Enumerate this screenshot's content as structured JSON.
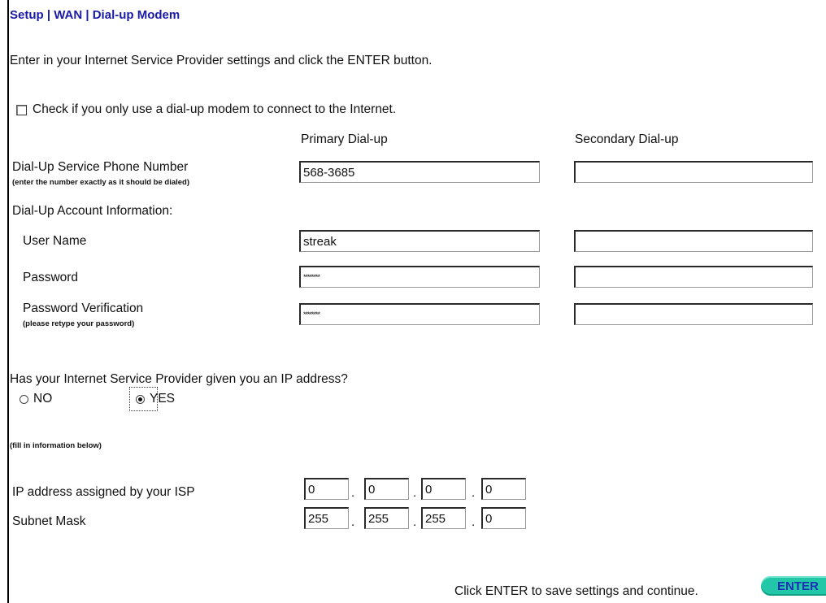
{
  "header": {
    "title": "Setup | WAN | Dial-up Modem"
  },
  "intro": "Enter in your Internet Service Provider settings and click the ENTER button.",
  "dialup_only": {
    "label": "Check if you only use a dial-up modem to connect to the Internet.",
    "checked": false
  },
  "columns": {
    "primary": "Primary Dial-up",
    "secondary": "Secondary Dial-up"
  },
  "phone": {
    "label": "Dial-Up Service Phone Number",
    "sublabel": "(enter the number exactly as it should be dialed)",
    "primary": "568-3685",
    "secondary": ""
  },
  "account": {
    "heading": "Dial-Up Account Information:"
  },
  "username": {
    "label": "User Name",
    "primary": "streak",
    "secondary": ""
  },
  "password": {
    "label": "Password",
    "primary": "********",
    "secondary": ""
  },
  "password_verify": {
    "label": "Password Verification",
    "sublabel": "(please retype your password)",
    "primary": "********",
    "secondary": ""
  },
  "ip_question": {
    "label": "Has your Internet Service Provider given you an IP address?",
    "no_label": "NO",
    "yes_label": "YES",
    "selected": "YES"
  },
  "fill_note": "(fill in information below)",
  "ip_address": {
    "label": "IP address assigned by your ISP",
    "octets": [
      "0",
      "0",
      "0",
      "0"
    ]
  },
  "subnet_mask": {
    "label": "Subnet Mask",
    "octets": [
      "255",
      "255",
      "255",
      "0"
    ]
  },
  "separator": ".",
  "footer": {
    "hint": "Click ENTER to save settings and continue.",
    "enter_label": "ENTER"
  },
  "colors": {
    "title": "#1a1aa6",
    "enter_bg": "#22c7a8",
    "enter_text": "#1a2fb5"
  }
}
